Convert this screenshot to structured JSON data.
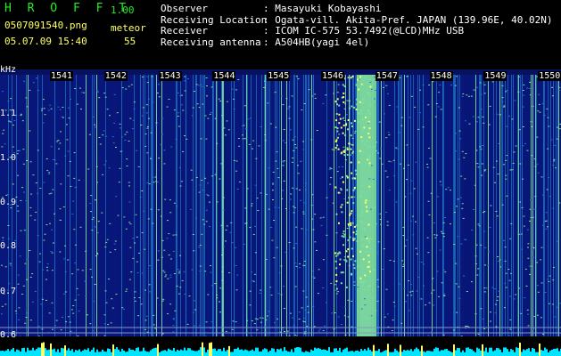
{
  "header": {
    "app_title": "H R O F F T",
    "version": "1.00",
    "filename": "0507091540.png",
    "mode_label": "meteor",
    "datetime": "05.07.09 15:40",
    "count": "55"
  },
  "station_info": [
    {
      "label": "Observer",
      "value": ": Masayuki Kobayashi"
    },
    {
      "label": "Receiving Location",
      "value": ": Ogata-vill. Akita-Pref. JAPAN (139.96E, 40.02N)"
    },
    {
      "label": "Receiver",
      "value": ": ICOM IC-575 53.7492(@LCD)MHz USB"
    },
    {
      "label": "Receiving antenna",
      "value": ": A504HB(yagi 4el)"
    }
  ],
  "chart_data": {
    "type": "heatmap",
    "ylabel": "kHz",
    "y_ticks": [
      "1.1",
      "1.0",
      "0.9",
      "0.8",
      "0.7",
      "0.6"
    ],
    "x_ticks": [
      "1541",
      "1542",
      "1543",
      "1544",
      "1545",
      "1546",
      "1547",
      "1548",
      "1549",
      "1550"
    ],
    "colors": {
      "background": "#000000",
      "low": "#0a1a8c",
      "mid": "#1e7bd0",
      "high": "#7fe0a0",
      "peak": "#ffff66",
      "baseline": "#00e5ff"
    }
  }
}
